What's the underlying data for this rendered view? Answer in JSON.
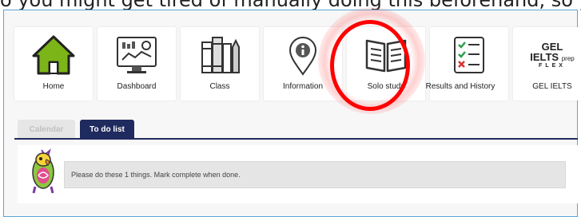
{
  "overlay_text": {
    "before": "o you might get ",
    "underlined": "tired",
    "after": " of manually doing this beforehand, so you can only be ready"
  },
  "nav_tiles": [
    {
      "label": "Home",
      "icon": "home-icon"
    },
    {
      "label": "Dashboard",
      "icon": "dashboard-monitor-icon"
    },
    {
      "label": "Class",
      "icon": "books-icon"
    },
    {
      "label": "Information",
      "icon": "info-pin-icon"
    },
    {
      "label": "Solo study",
      "icon": "open-book-icon"
    },
    {
      "label": "Results and History",
      "icon": "checklist-icon"
    },
    {
      "label": "GEL IELTS",
      "icon": "gel-ielts-logo"
    }
  ],
  "gel_logo": {
    "line1": "GEL",
    "line2": "IELTS",
    "line2_small": "prep",
    "line3": "FLEX"
  },
  "tabs": [
    {
      "label": "Calendar",
      "active": false
    },
    {
      "label": "To do list",
      "active": true
    }
  ],
  "notice_text": "Please do these 1 things. Mark complete when done.",
  "colors": {
    "accent_navy": "#1f2a5e",
    "home_green": "#7cb518",
    "highlight_red": "#ff0000",
    "frame_border": "#5aa6d6"
  }
}
